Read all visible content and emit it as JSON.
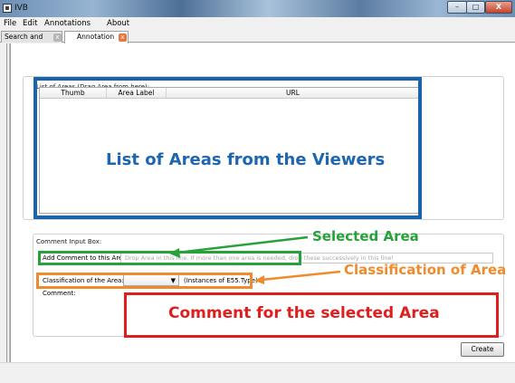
{
  "window": {
    "title": "IVB",
    "minimize": "–",
    "maximize": "□",
    "close": "X"
  },
  "menu": {
    "file": "File",
    "edit": "Edit",
    "annotations": "Annotations",
    "about": "About"
  },
  "tabs": [
    {
      "label": "Search and Browse",
      "close": "x"
    },
    {
      "label": "Annotation",
      "close": "x"
    }
  ],
  "list_box": {
    "label": "List of Areas (Drag Area from here):",
    "columns": [
      "Thumb",
      "Area Label",
      "URL"
    ]
  },
  "comment_box": {
    "label": "Comment Input Box:",
    "add_comment_label": "Add Comment to this Area:",
    "add_comment_placeholder": "Drop Area in this line. If more than one area is needed, drop these successively in this line!",
    "classification_label": "Classification of the Area:",
    "classification_value": "",
    "instances_label": "(Instances of E55.Type)",
    "comment_label": "Comment:"
  },
  "create_button": "Create",
  "annotations": {
    "list_of_areas": "List of Areas from the Viewers",
    "selected_area": "Selected Area",
    "classification": "Classification of Area",
    "comment": "Comment for the selected Area"
  },
  "colors": {
    "blue": "#1a63ad",
    "green": "#27a23a",
    "orange": "#ef8b2c",
    "red": "#e01e1e"
  }
}
